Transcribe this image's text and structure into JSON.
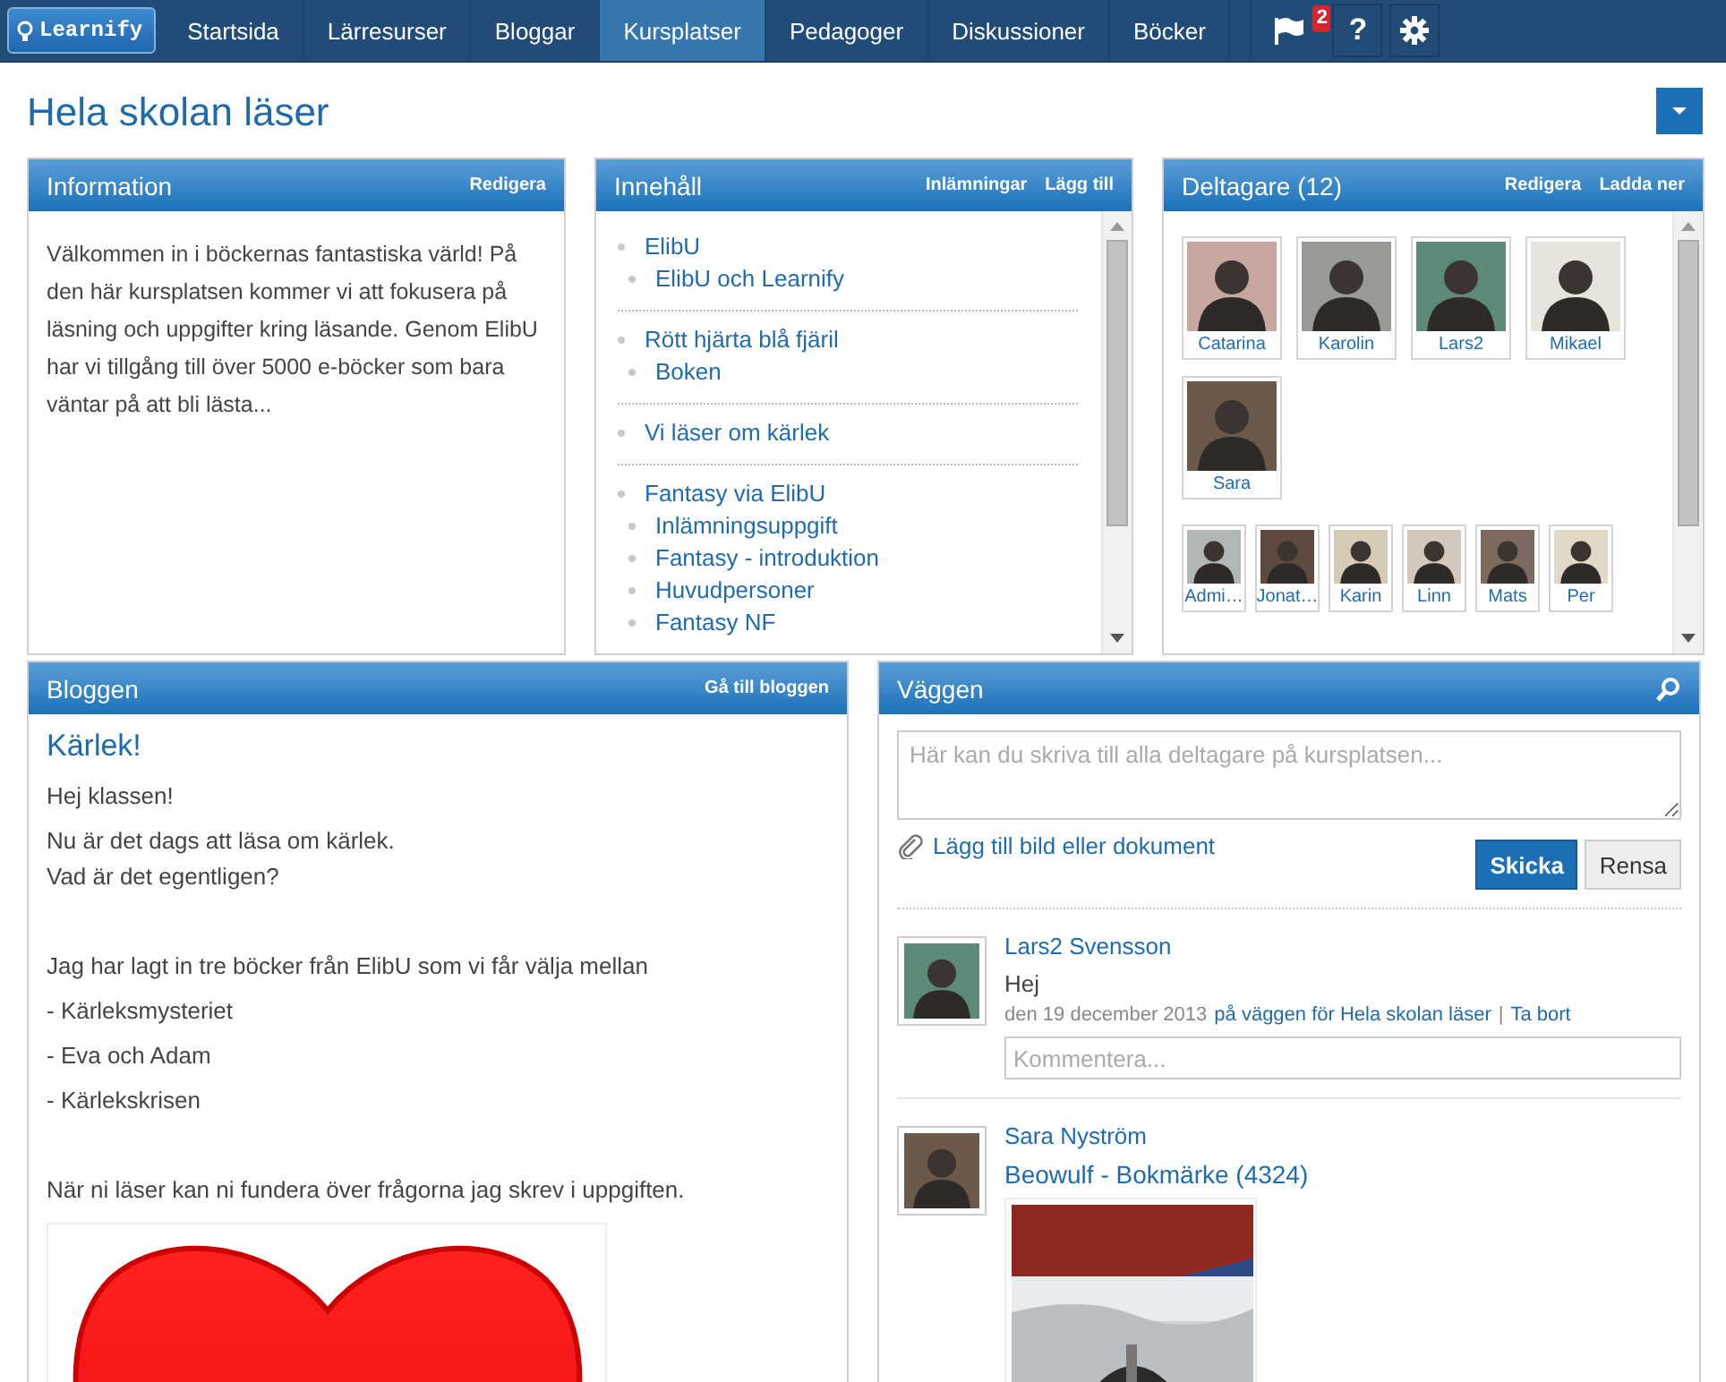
{
  "nav": {
    "logo": "Learnify",
    "tabs": [
      {
        "label": "Startsida",
        "selected": false
      },
      {
        "label": "Lärresurser",
        "selected": false
      },
      {
        "label": "Bloggar",
        "selected": false
      },
      {
        "label": "Kursplatser",
        "selected": true
      },
      {
        "label": "Pedagoger",
        "selected": false
      },
      {
        "label": "Diskussioner",
        "selected": false
      },
      {
        "label": "Böcker",
        "selected": false
      }
    ],
    "notification_count": "2",
    "help": "?"
  },
  "page": {
    "title": "Hela skolan läser"
  },
  "information": {
    "title": "Information",
    "actions": [
      "Redigera"
    ],
    "text": "Välkommen in i böckernas fantastiska värld! På den här kursplatsen kommer vi att fokusera på läsning och uppgifter kring läsande. Genom ElibU har vi tillgång till över 5000 e-böcker som bara väntar på att bli lästa..."
  },
  "contents": {
    "title": "Innehåll",
    "actions": [
      "Inlämningar",
      "Lägg till"
    ],
    "sections": [
      {
        "label": "ElibU",
        "children": [
          {
            "label": "ElibU och Learnify"
          }
        ]
      },
      {
        "label": "Rött hjärta blå fjäril",
        "children": [
          {
            "label": "Boken"
          }
        ]
      },
      {
        "label": "Vi läser om kärlek"
      },
      {
        "label": "Fantasy via ElibU",
        "children": [
          {
            "label": "Inlämningsuppgift"
          },
          {
            "label": "Fantasy - introduktion"
          },
          {
            "label": "Huvudpersoner"
          },
          {
            "label": "Fantasy NF"
          }
        ]
      }
    ]
  },
  "participants": {
    "title": "Deltagare (12)",
    "actions": [
      "Redigera",
      "Ladda ner"
    ],
    "teachers": [
      {
        "name": "Catarina"
      },
      {
        "name": "Karolin"
      },
      {
        "name": "Lars2"
      },
      {
        "name": "Mikael"
      },
      {
        "name": "Sara"
      }
    ],
    "students": [
      {
        "name": "Admi…"
      },
      {
        "name": "Jonat…"
      },
      {
        "name": "Karin"
      },
      {
        "name": "Linn"
      },
      {
        "name": "Mats"
      },
      {
        "name": "Per"
      }
    ]
  },
  "blog": {
    "title": "Bloggen",
    "actions": [
      "Gå till bloggen"
    ],
    "post_title": "Kärlek!",
    "blocks": [
      {
        "lines": [
          "Hej klassen!"
        ],
        "gap_before": false
      },
      {
        "lines": [
          "Nu är det dags att läsa om kärlek.",
          "Vad är det egentligen?"
        ],
        "gap_before": false
      },
      {
        "lines": [
          "Jag har lagt in tre böcker från ElibU som vi får välja mellan"
        ],
        "gap_before": true
      },
      {
        "lines": [
          "- Kärleksmysteriet"
        ],
        "gap_before": false
      },
      {
        "lines": [
          "- Eva och Adam"
        ],
        "gap_before": false
      },
      {
        "lines": [
          "- Kärlekskrisen"
        ],
        "gap_before": false
      },
      {
        "lines": [
          "När ni läser kan ni fundera över frågorna jag skrev i uppgiften."
        ],
        "gap_before": true
      }
    ]
  },
  "wall": {
    "title": "Väggen",
    "placeholder": "Här kan du skriva till alla deltagare på kursplatsen...",
    "attach": "Lägg till bild eller dokument",
    "buttons": [
      {
        "label": "Skicka",
        "kind": "primary"
      },
      {
        "label": "Rensa",
        "kind": "secondary"
      }
    ],
    "posts": [
      {
        "kind": "status",
        "author": "Lars2 Svensson",
        "text": "Hej",
        "date": "den 19 december 2013",
        "wall_link": "på väggen för Hela skolan läser",
        "separator": "|",
        "delete": "Ta bort",
        "comment_placeholder": "Kommentera..."
      },
      {
        "kind": "bookmark",
        "author": "Sara Nyström",
        "title": "Beowulf - Bokmärke (4324)"
      }
    ]
  }
}
